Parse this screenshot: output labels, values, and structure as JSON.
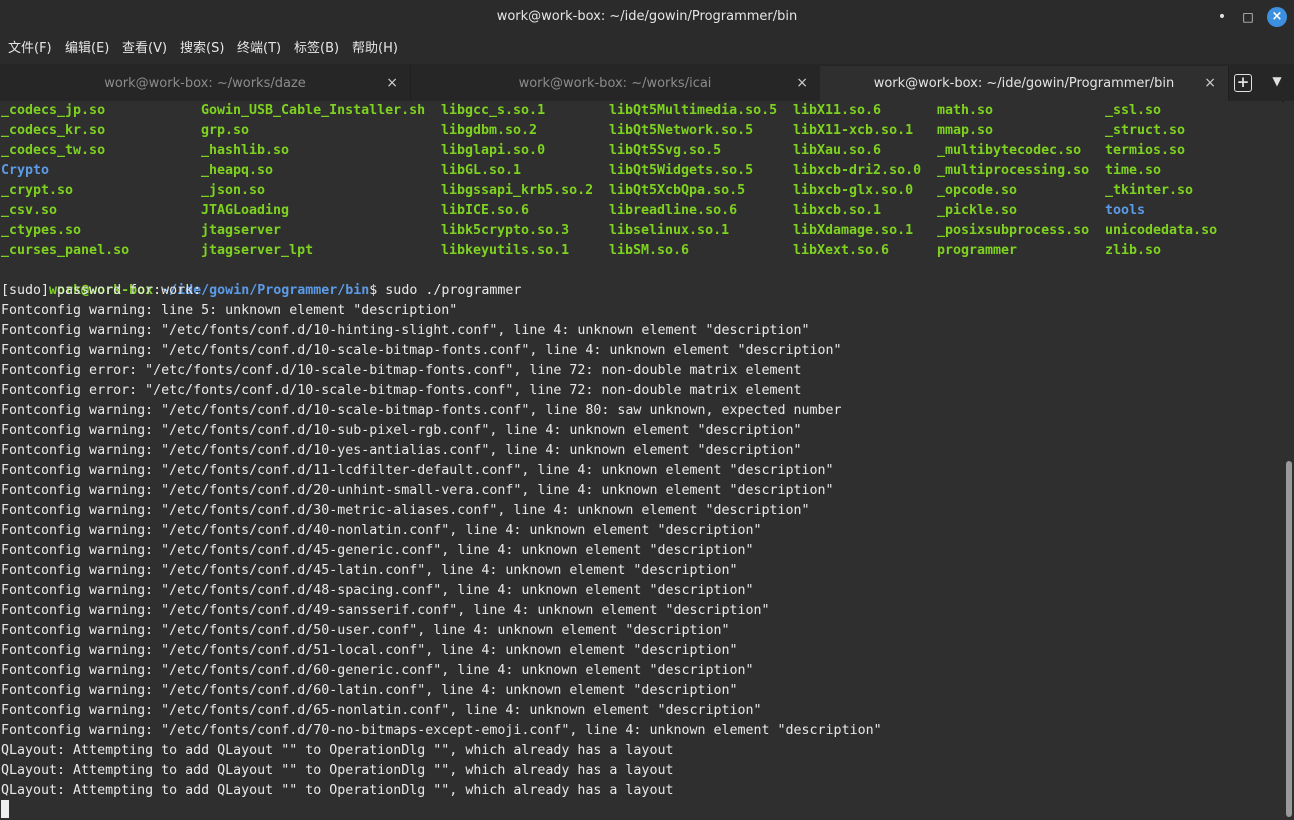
{
  "window": {
    "title": "work@work-box: ~/ide/gowin/Programmer/bin"
  },
  "menu": [
    "文件(F)",
    "编辑(E)",
    "查看(V)",
    "搜索(S)",
    "终端(T)",
    "标签(B)",
    "帮助(H)"
  ],
  "tabs": [
    {
      "label": "work@work-box: ~/works/daze"
    },
    {
      "label": "work@work-box: ~/works/icai"
    },
    {
      "label": "work@work-box: ~/ide/gowin/Programmer/bin"
    }
  ],
  "icons": {
    "close": "×",
    "new_tab": "+",
    "tab_menu": "▼",
    "minimize": "•",
    "maximize": "□",
    "window_close": "×"
  },
  "colors": {
    "executable": "#7ed321",
    "directory": "#5c9be8",
    "text": "#e9e9e9",
    "background": "#2f2f2f"
  },
  "listing": [
    [
      {
        "t": "_codecs_jp.so",
        "c": "g"
      },
      {
        "t": "Gowin_USB_Cable_Installer.sh",
        "c": "g"
      },
      {
        "t": "libgcc_s.so.1",
        "c": "g"
      },
      {
        "t": "libQt5Multimedia.so.5",
        "c": "g"
      },
      {
        "t": "libX11.so.6",
        "c": "g"
      },
      {
        "t": "math.so",
        "c": "g"
      },
      {
        "t": "_ssl.so",
        "c": "g"
      }
    ],
    [
      {
        "t": "_codecs_kr.so",
        "c": "g"
      },
      {
        "t": "grp.so",
        "c": "g"
      },
      {
        "t": "libgdbm.so.2",
        "c": "g"
      },
      {
        "t": "libQt5Network.so.5",
        "c": "g"
      },
      {
        "t": "libX11-xcb.so.1",
        "c": "g"
      },
      {
        "t": "mmap.so",
        "c": "g"
      },
      {
        "t": "_struct.so",
        "c": "g"
      }
    ],
    [
      {
        "t": "_codecs_tw.so",
        "c": "g"
      },
      {
        "t": "_hashlib.so",
        "c": "g"
      },
      {
        "t": "libglapi.so.0",
        "c": "g"
      },
      {
        "t": "libQt5Svg.so.5",
        "c": "g"
      },
      {
        "t": "libXau.so.6",
        "c": "g"
      },
      {
        "t": "_multibytecodec.so",
        "c": "g"
      },
      {
        "t": "termios.so",
        "c": "g"
      }
    ],
    [
      {
        "t": "Crypto",
        "c": "b"
      },
      {
        "t": "_heapq.so",
        "c": "g"
      },
      {
        "t": "libGL.so.1",
        "c": "g"
      },
      {
        "t": "libQt5Widgets.so.5",
        "c": "g"
      },
      {
        "t": "libxcb-dri2.so.0",
        "c": "g"
      },
      {
        "t": "_multiprocessing.so",
        "c": "g"
      },
      {
        "t": "time.so",
        "c": "g"
      }
    ],
    [
      {
        "t": "_crypt.so",
        "c": "g"
      },
      {
        "t": "_json.so",
        "c": "g"
      },
      {
        "t": "libgssapi_krb5.so.2",
        "c": "g"
      },
      {
        "t": "libQt5XcbQpa.so.5",
        "c": "g"
      },
      {
        "t": "libxcb-glx.so.0",
        "c": "g"
      },
      {
        "t": "_opcode.so",
        "c": "g"
      },
      {
        "t": "_tkinter.so",
        "c": "g"
      }
    ],
    [
      {
        "t": "_csv.so",
        "c": "g"
      },
      {
        "t": "JTAGLoading",
        "c": "g"
      },
      {
        "t": "libICE.so.6",
        "c": "g"
      },
      {
        "t": "libreadline.so.6",
        "c": "g"
      },
      {
        "t": "libxcb.so.1",
        "c": "g"
      },
      {
        "t": "_pickle.so",
        "c": "g"
      },
      {
        "t": "tools",
        "c": "b"
      }
    ],
    [
      {
        "t": "_ctypes.so",
        "c": "g"
      },
      {
        "t": "jtagserver",
        "c": "g"
      },
      {
        "t": "libk5crypto.so.3",
        "c": "g"
      },
      {
        "t": "libselinux.so.1",
        "c": "g"
      },
      {
        "t": "libXdamage.so.1",
        "c": "g"
      },
      {
        "t": "_posixsubprocess.so",
        "c": "g"
      },
      {
        "t": "unicodedata.so",
        "c": "g"
      }
    ],
    [
      {
        "t": "_curses_panel.so",
        "c": "g"
      },
      {
        "t": "jtagserver_lpt",
        "c": "g"
      },
      {
        "t": "libkeyutils.so.1",
        "c": "g"
      },
      {
        "t": "libSM.so.6",
        "c": "g"
      },
      {
        "t": "libXext.so.6",
        "c": "g"
      },
      {
        "t": "programmer",
        "c": "g"
      },
      {
        "t": "zlib.so",
        "c": "g"
      }
    ]
  ],
  "prompt": {
    "user": "work@work-box",
    "sep": ":",
    "path": "~/ide/gowin/Programmer/bin",
    "symbol": "$",
    "command": " sudo ./programmer"
  },
  "output": [
    "[sudo] password for work:",
    "Fontconfig warning: line 5: unknown element \"description\"",
    "Fontconfig warning: \"/etc/fonts/conf.d/10-hinting-slight.conf\", line 4: unknown element \"description\"",
    "Fontconfig warning: \"/etc/fonts/conf.d/10-scale-bitmap-fonts.conf\", line 4: unknown element \"description\"",
    "Fontconfig error: \"/etc/fonts/conf.d/10-scale-bitmap-fonts.conf\", line 72: non-double matrix element",
    "Fontconfig error: \"/etc/fonts/conf.d/10-scale-bitmap-fonts.conf\", line 72: non-double matrix element",
    "Fontconfig warning: \"/etc/fonts/conf.d/10-scale-bitmap-fonts.conf\", line 80: saw unknown, expected number",
    "Fontconfig warning: \"/etc/fonts/conf.d/10-sub-pixel-rgb.conf\", line 4: unknown element \"description\"",
    "Fontconfig warning: \"/etc/fonts/conf.d/10-yes-antialias.conf\", line 4: unknown element \"description\"",
    "Fontconfig warning: \"/etc/fonts/conf.d/11-lcdfilter-default.conf\", line 4: unknown element \"description\"",
    "Fontconfig warning: \"/etc/fonts/conf.d/20-unhint-small-vera.conf\", line 4: unknown element \"description\"",
    "Fontconfig warning: \"/etc/fonts/conf.d/30-metric-aliases.conf\", line 4: unknown element \"description\"",
    "Fontconfig warning: \"/etc/fonts/conf.d/40-nonlatin.conf\", line 4: unknown element \"description\"",
    "Fontconfig warning: \"/etc/fonts/conf.d/45-generic.conf\", line 4: unknown element \"description\"",
    "Fontconfig warning: \"/etc/fonts/conf.d/45-latin.conf\", line 4: unknown element \"description\"",
    "Fontconfig warning: \"/etc/fonts/conf.d/48-spacing.conf\", line 4: unknown element \"description\"",
    "Fontconfig warning: \"/etc/fonts/conf.d/49-sansserif.conf\", line 4: unknown element \"description\"",
    "Fontconfig warning: \"/etc/fonts/conf.d/50-user.conf\", line 4: unknown element \"description\"",
    "Fontconfig warning: \"/etc/fonts/conf.d/51-local.conf\", line 4: unknown element \"description\"",
    "Fontconfig warning: \"/etc/fonts/conf.d/60-generic.conf\", line 4: unknown element \"description\"",
    "Fontconfig warning: \"/etc/fonts/conf.d/60-latin.conf\", line 4: unknown element \"description\"",
    "Fontconfig warning: \"/etc/fonts/conf.d/65-nonlatin.conf\", line 4: unknown element \"description\"",
    "Fontconfig warning: \"/etc/fonts/conf.d/70-no-bitmaps-except-emoji.conf\", line 4: unknown element \"description\"",
    "QLayout: Attempting to add QLayout \"\" to OperationDlg \"\", which already has a layout",
    "QLayout: Attempting to add QLayout \"\" to OperationDlg \"\", which already has a layout",
    "QLayout: Attempting to add QLayout \"\" to OperationDlg \"\", which already has a layout"
  ]
}
